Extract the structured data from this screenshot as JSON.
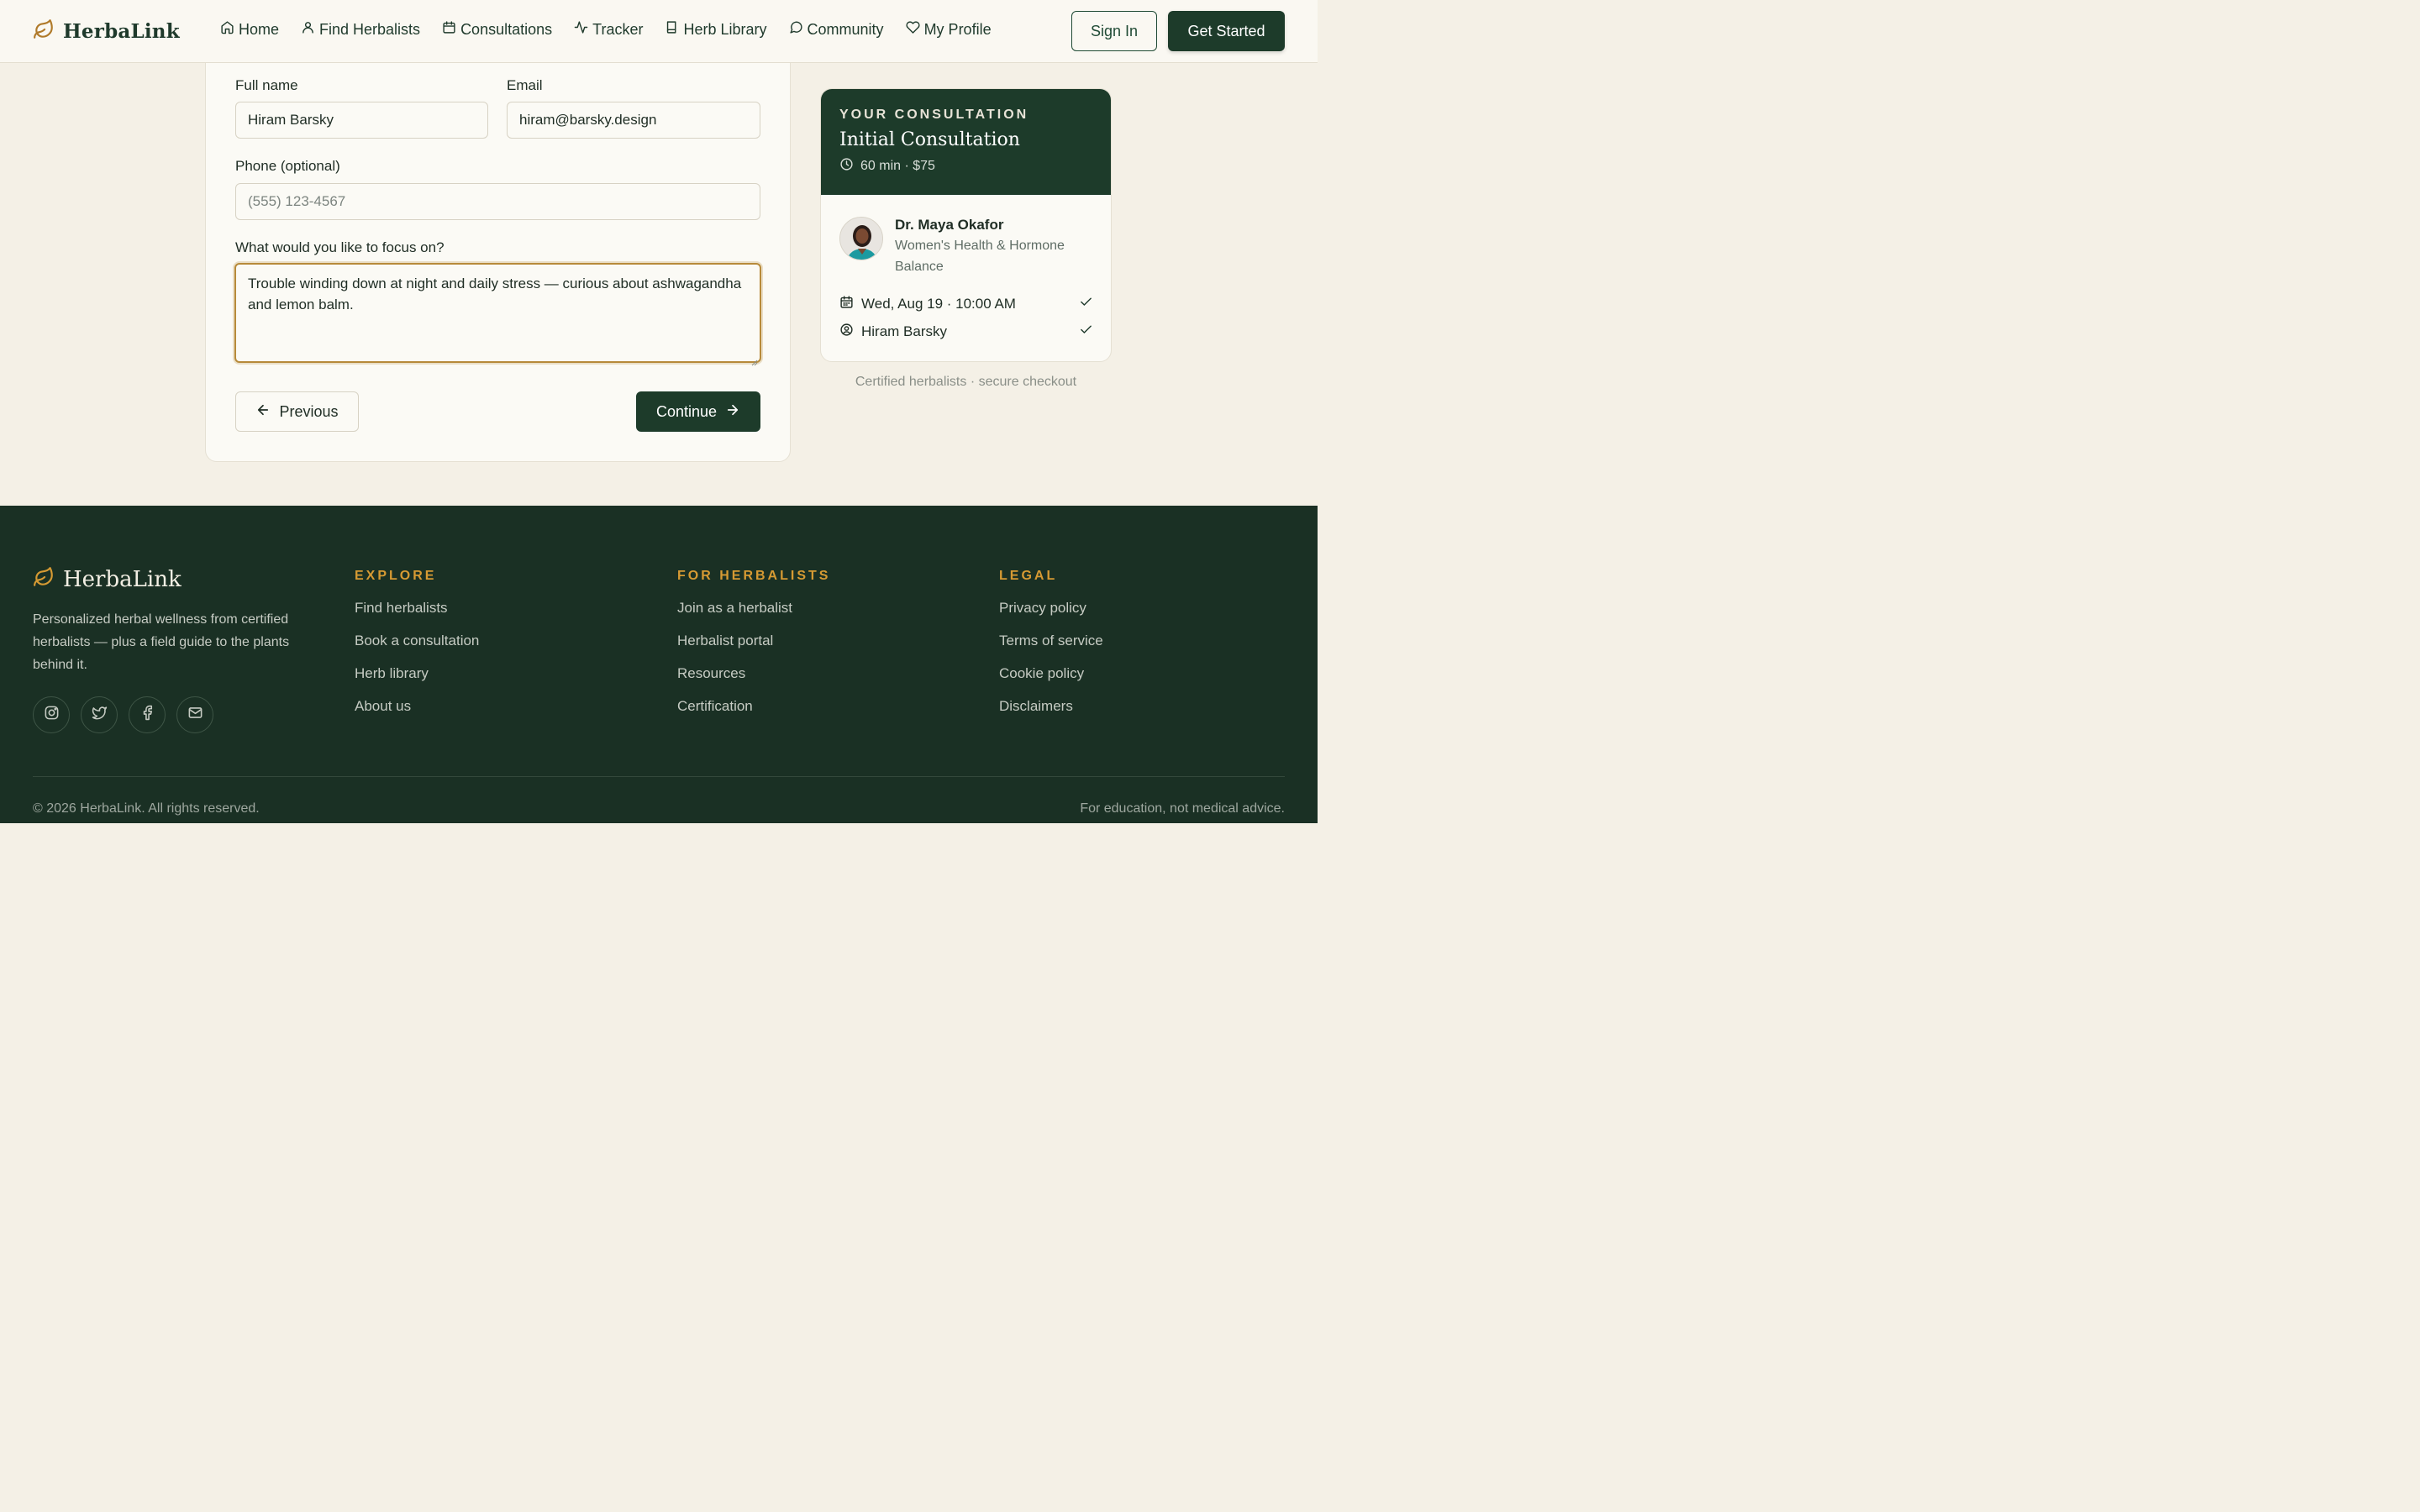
{
  "header": {
    "brand": "HerbaLink",
    "nav": [
      {
        "label": "Home",
        "icon": "home-icon"
      },
      {
        "label": "Find Herbalists",
        "icon": "user-icon"
      },
      {
        "label": "Consultations",
        "icon": "calendar-icon"
      },
      {
        "label": "Tracker",
        "icon": "activity-icon"
      },
      {
        "label": "Herb Library",
        "icon": "book-icon"
      },
      {
        "label": "Community",
        "icon": "chat-bubble-icon"
      },
      {
        "label": "My Profile",
        "icon": "heart-icon"
      }
    ],
    "sign_in": "Sign In",
    "get_started": "Get Started"
  },
  "form": {
    "full_name_label": "Full name",
    "full_name_value": "Hiram Barsky",
    "email_label": "Email",
    "email_value": "hiram@barsky.design",
    "phone_label": "Phone (optional)",
    "phone_placeholder": "(555) 123-4567",
    "focus_label": "What would you like to focus on?",
    "focus_value": "Trouble winding down at night and daily stress — curious about ashwagandha and lemon balm.",
    "previous": "Previous",
    "continue": "Continue"
  },
  "summary": {
    "eyebrow": "YOUR CONSULTATION",
    "title": "Initial Consultation",
    "meta": "60 min · $75",
    "doctor_name": "Dr. Maya Okafor",
    "doctor_specialty": "Women's Health & Hormone Balance",
    "date": "Wed, Aug 19 · 10:00 AM",
    "client": "Hiram Barsky",
    "note": "Certified herbalists · secure checkout"
  },
  "footer": {
    "brand": "HerbaLink",
    "description": "Personalized herbal wellness from certified herbalists — plus a field guide to the plants behind it.",
    "socials": [
      "instagram-icon",
      "twitter-icon",
      "facebook-icon",
      "mail-icon"
    ],
    "columns": [
      {
        "title": "EXPLORE",
        "links": [
          "Find herbalists",
          "Book a consultation",
          "Herb library",
          "About us"
        ]
      },
      {
        "title": "FOR HERBALISTS",
        "links": [
          "Join as a herbalist",
          "Herbalist portal",
          "Resources",
          "Certification"
        ]
      },
      {
        "title": "LEGAL",
        "links": [
          "Privacy policy",
          "Terms of service",
          "Cookie policy",
          "Disclaimers"
        ]
      }
    ],
    "copyright": "© 2026 HerbaLink. All rights reserved.",
    "note": "For education, not medical advice."
  },
  "colors": {
    "primary": "#1d3b2a",
    "accent": "#d69a33",
    "background": "#f4f0e6",
    "focus_ring": "#b78a3a"
  }
}
